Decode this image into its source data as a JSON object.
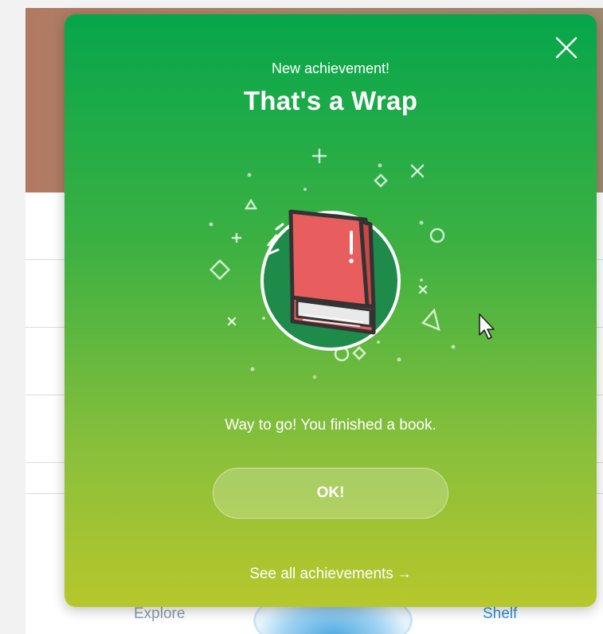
{
  "modal": {
    "subtitle": "New achievement!",
    "title": "That's a Wrap",
    "message": "Way to go! You finished a book.",
    "ok_label": "OK!",
    "see_all_label": "See all achievements",
    "arrow": "→",
    "close_icon": "close-icon",
    "illustration_icon": "book-icon"
  },
  "background_nav": {
    "explore_label": "Explore",
    "shelf_label": "Shelf"
  },
  "colors": {
    "modal_top": "#06a64c",
    "modal_bottom": "#b6c72c",
    "book_red": "#e85d5d",
    "circle_green": "#1e8a4a",
    "shelf_active": "#2e8fd6"
  }
}
